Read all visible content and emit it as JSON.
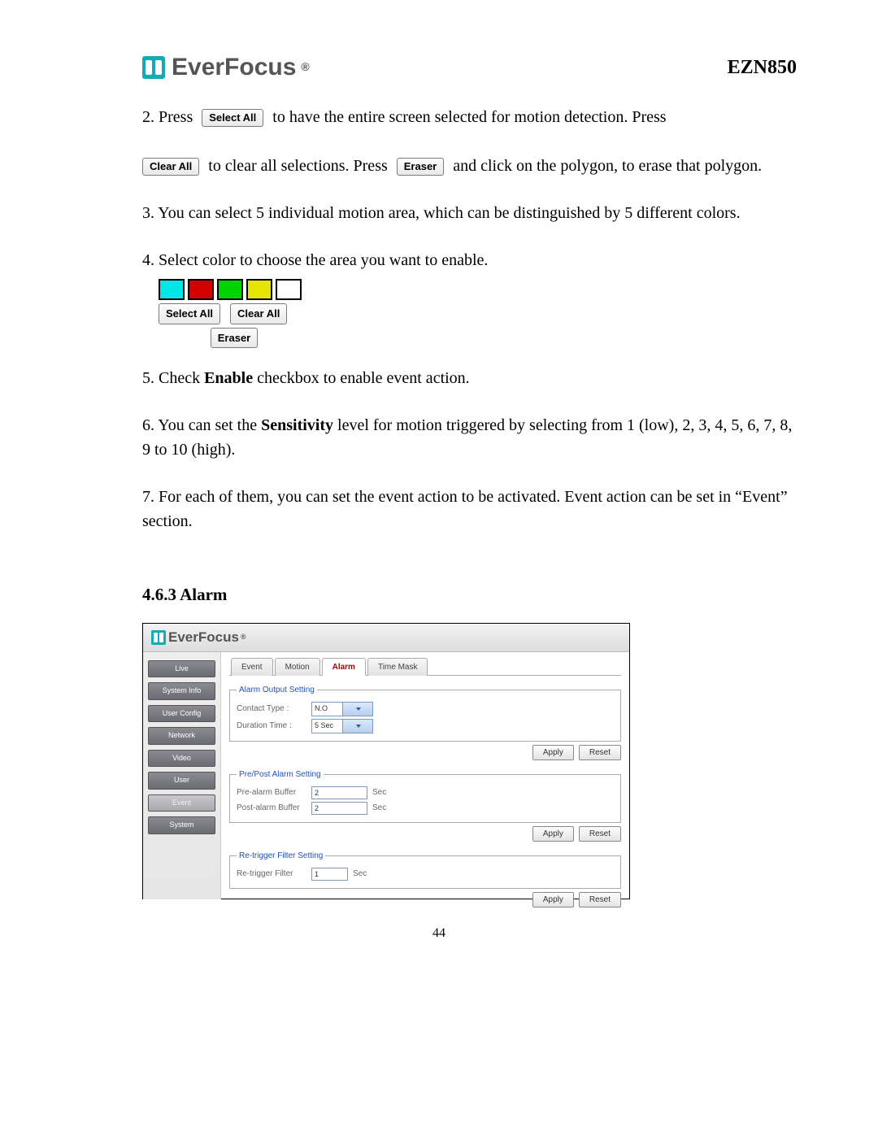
{
  "header": {
    "brand": "EverFocus",
    "model": "EZN850"
  },
  "instructions": {
    "step2_a": "2. Press",
    "step2_btn1": "Select All",
    "step2_b": "to have the entire screen selected for motion detection. Press",
    "step2_btn2": "Clear All",
    "step2_c": "to clear all selections. Press",
    "step2_btn3": "Eraser",
    "step2_d": "and click on the polygon, to erase that polygon.",
    "step3": "3. You can select 5 individual motion area, which can be distinguished by 5 different colors.",
    "step4": "4. Select color to choose the area you want to enable.",
    "panel": {
      "colors": [
        "#00e5e5",
        "#d40000",
        "#00d400",
        "#e5e500",
        "#ffffff"
      ],
      "select_all": "Select All",
      "clear_all": "Clear All",
      "eraser": "Eraser"
    },
    "step5_a": "5. Check ",
    "step5_b": "Enable",
    "step5_c": " checkbox to enable event action.",
    "step6_a": "6. You can set the ",
    "step6_b": "Sensitivity",
    "step6_c": " level for motion triggered by selecting from 1 (low), 2, 3, 4, 5, 6, 7, 8, 9 to 10 (high).",
    "step7": "7. For each of them, you can set the event action to be activated. Event action can be set in “Event” section."
  },
  "section_heading": "4.6.3 Alarm",
  "screenshot": {
    "brand": "EverFocus",
    "sidebar": [
      "Live",
      "System Info",
      "User Config",
      "Network",
      "Video",
      "User",
      "Event",
      "System"
    ],
    "sidebar_selected": "Event",
    "tabs": [
      "Event",
      "Motion",
      "Alarm",
      "Time Mask"
    ],
    "tab_selected": "Alarm",
    "groups": {
      "alarm_output": {
        "legend": "Alarm Output Setting",
        "contact_type_label": "Contact Type :",
        "contact_type_value": "N.O",
        "duration_label": "Duration Time :",
        "duration_value": "5 Sec"
      },
      "pre_post": {
        "legend": "Pre/Post Alarm Setting",
        "pre_label": "Pre-alarm Buffer",
        "pre_value": "2",
        "post_label": "Post-alarm Buffer",
        "post_value": "2",
        "unit": "Sec"
      },
      "retrigger": {
        "legend": "Re-trigger Filter Setting",
        "label": "Re-trigger Filter",
        "value": "1",
        "unit": "Sec"
      }
    },
    "buttons": {
      "apply": "Apply",
      "reset": "Reset"
    }
  },
  "page_number": "44"
}
